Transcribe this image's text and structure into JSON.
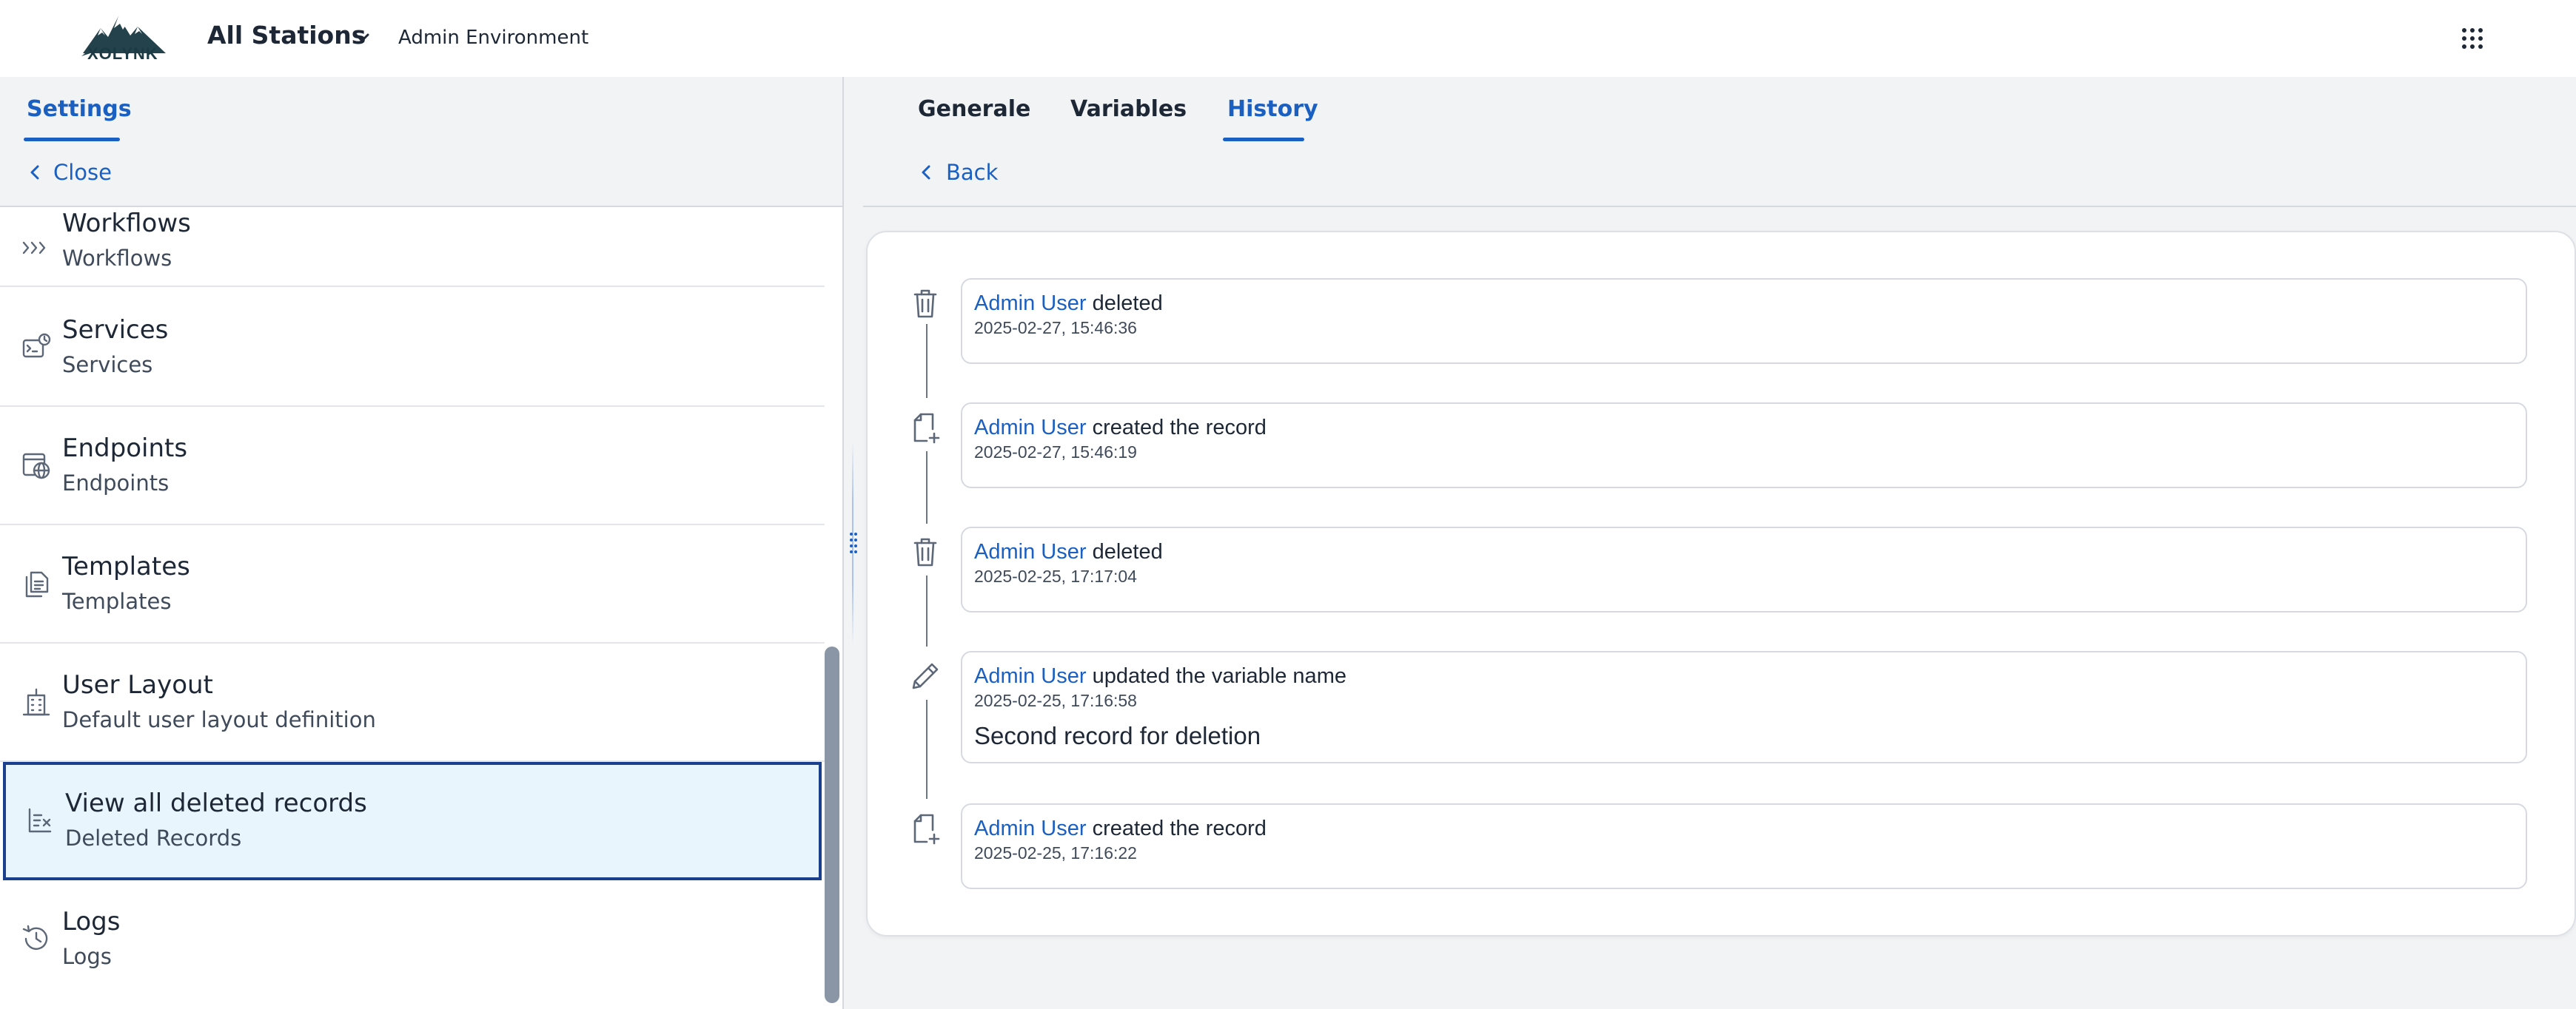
{
  "header": {
    "logo_text": "XOLYNK",
    "station": "All Stations",
    "environment": "Admin Environment"
  },
  "left": {
    "tab": "Settings",
    "close": "Close",
    "items": [
      {
        "title": "Workflows",
        "subtitle": "Workflows",
        "icon": "workflow-icon"
      },
      {
        "title": "Services",
        "subtitle": "Services",
        "icon": "services-icon"
      },
      {
        "title": "Endpoints",
        "subtitle": "Endpoints",
        "icon": "endpoints-icon"
      },
      {
        "title": "Templates",
        "subtitle": "Templates",
        "icon": "templates-icon"
      },
      {
        "title": "User Layout",
        "subtitle": "Default user layout definition",
        "icon": "building-icon"
      },
      {
        "title": "View all deleted records",
        "subtitle": "Deleted Records",
        "icon": "deleted-records-icon"
      },
      {
        "title": "Logs",
        "subtitle": "Logs",
        "icon": "history-clock-icon"
      }
    ]
  },
  "right": {
    "tabs": [
      "Generale",
      "Variables",
      "History"
    ],
    "active_tab": "History",
    "back": "Back"
  },
  "history": [
    {
      "user": "Admin User",
      "action": "deleted",
      "time": "2025-02-27, 15:46:36",
      "icon": "trash-icon"
    },
    {
      "user": "Admin User",
      "action": "created the record",
      "time": "2025-02-27, 15:46:19",
      "icon": "file-plus-icon"
    },
    {
      "user": "Admin User",
      "action": "deleted",
      "time": "2025-02-25, 17:17:04",
      "icon": "trash-icon"
    },
    {
      "user": "Admin User",
      "action": "updated the variable name",
      "time": "2025-02-25, 17:16:58",
      "detail": "Second record for deletion",
      "icon": "pencil-icon"
    },
    {
      "user": "Admin User",
      "action": "created the record",
      "time": "2025-02-25, 17:16:22",
      "icon": "file-plus-icon"
    }
  ],
  "colors": {
    "accent": "#1a5fc2",
    "selected_bg": "#e8f5fd",
    "selected_border": "#1a3f8c"
  }
}
